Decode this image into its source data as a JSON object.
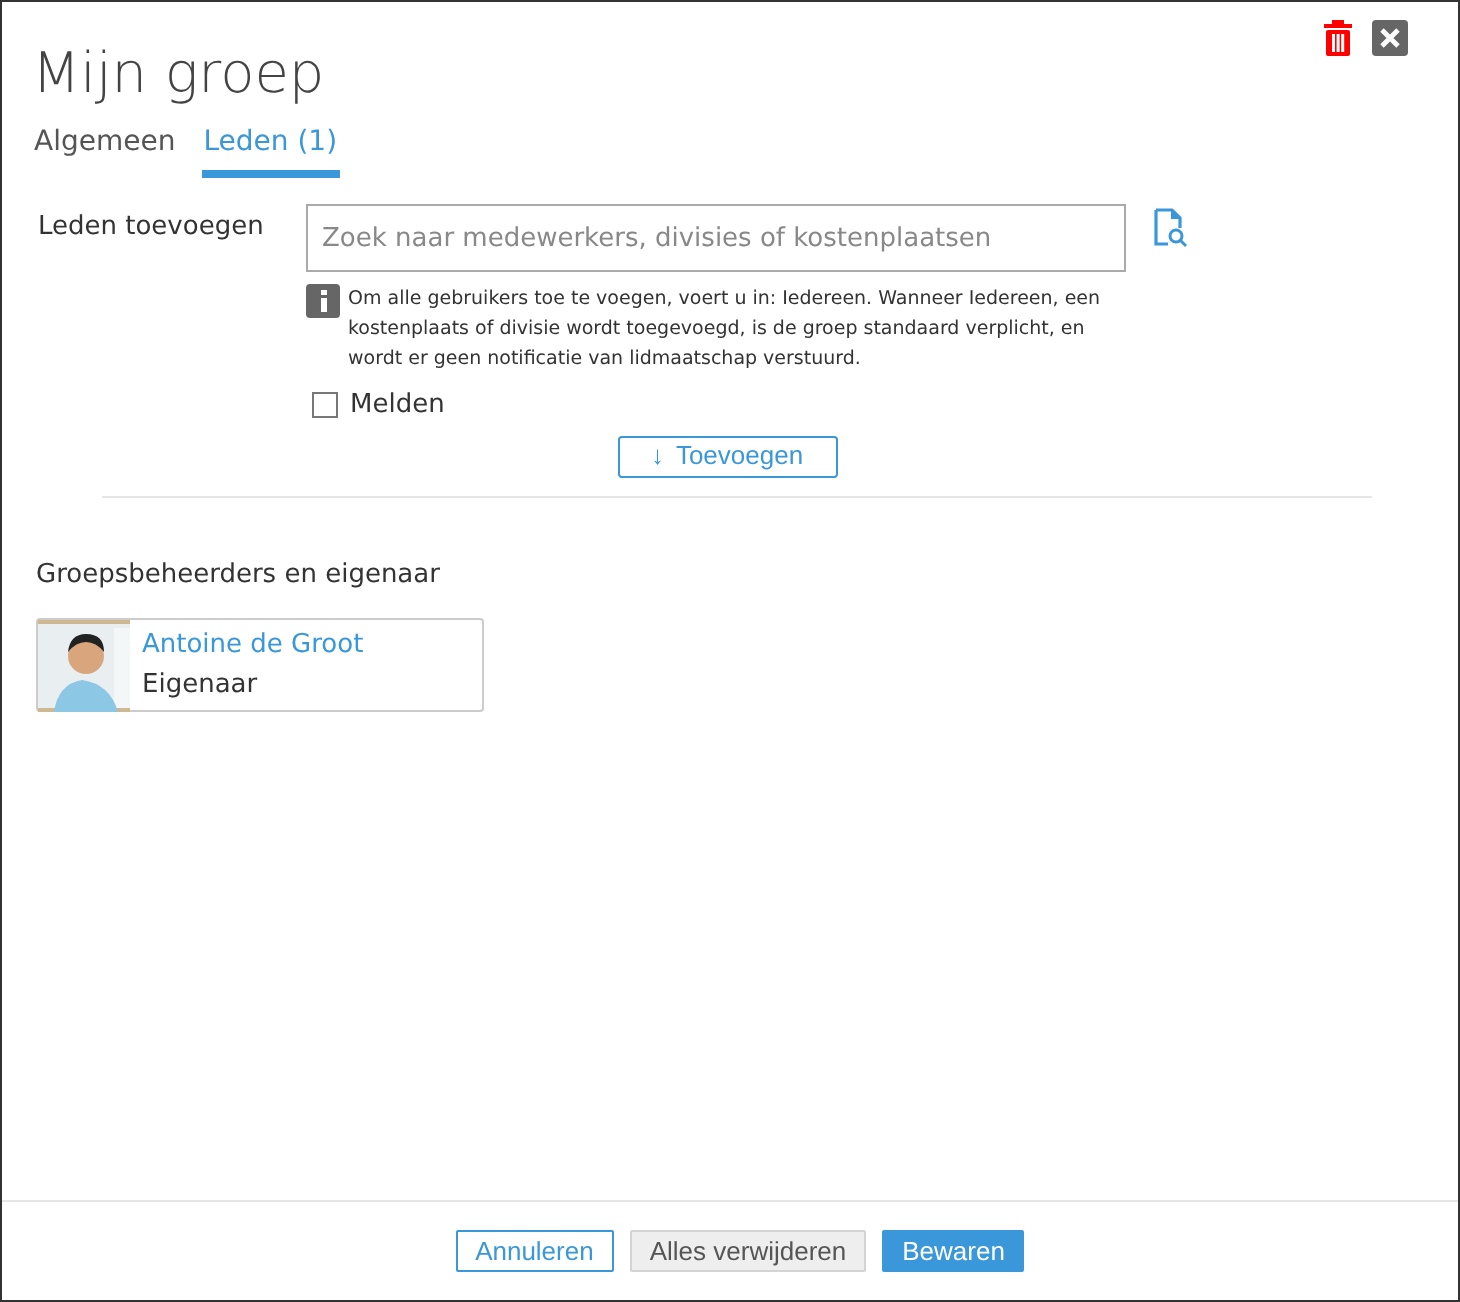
{
  "window": {
    "title": "Mijn groep"
  },
  "tabs": [
    {
      "label": "Algemeen",
      "selected": false
    },
    {
      "label": "Leden (1)",
      "selected": true
    }
  ],
  "add_members": {
    "label": "Leden toevoegen",
    "search": {
      "placeholder": "Zoek naar medewerkers, divisies of kostenplaatsen"
    },
    "info": "Om alle gebruikers toe te voegen, voert u in: Iedereen. Wanneer Iedereen, een kostenplaats of divisie wordt toegevoegd, is de groep standaard verplicht, en wordt er geen notificatie van lidmaatschap verstuurd.",
    "notify": {
      "label": "Melden",
      "checked": false
    },
    "add_button": {
      "arrow": "↓",
      "label": "Toevoegen"
    }
  },
  "owners": {
    "title": "Groepsbeheerders en eigenaar",
    "members": [
      {
        "name": "Antoine de Groot",
        "role": "Eigenaar"
      }
    ]
  },
  "footer_buttons": [
    {
      "label": "Annuleren",
      "kind": "outline"
    },
    {
      "label": "Alles verwijderen",
      "kind": "secondary"
    },
    {
      "label": "Bewaren",
      "kind": "primary"
    }
  ]
}
